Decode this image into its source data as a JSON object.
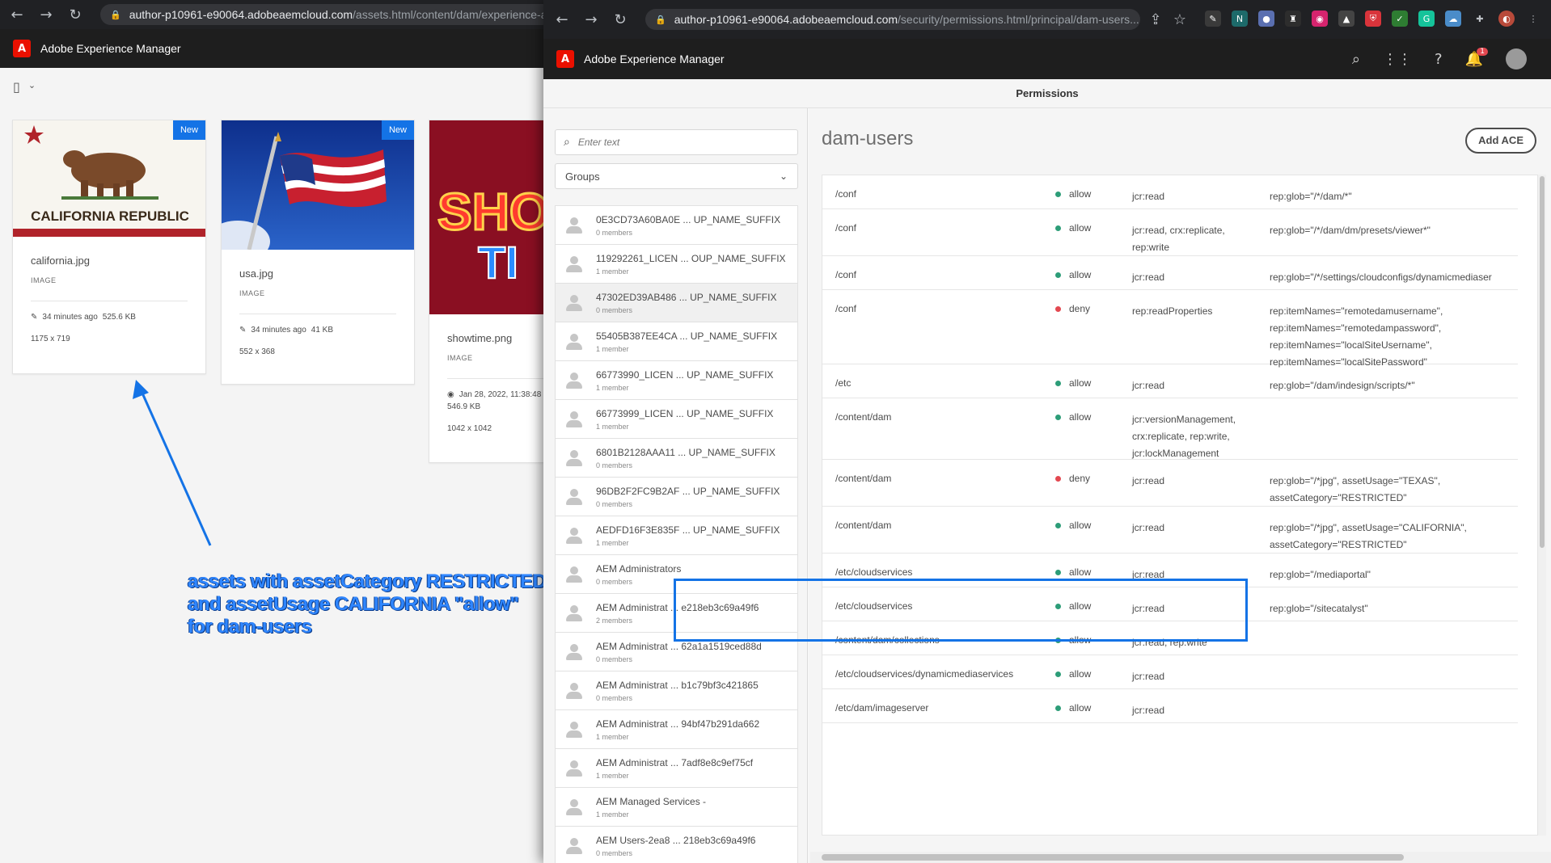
{
  "back_window": {
    "url_host": "author-p10961-e90064.adobeaemcloud.com",
    "url_path": "/assets.html/content/dam/experience-aem",
    "app_title": "Adobe Experience Manager",
    "cards": [
      {
        "name": "california.jpg",
        "type": "IMAGE",
        "modified": "34 minutes ago",
        "size": "525.6 KB",
        "dims": "1175 x 719",
        "badge": "New"
      },
      {
        "name": "usa.jpg",
        "type": "IMAGE",
        "modified": "34 minutes ago",
        "size": "41 KB",
        "dims": "552 x 368",
        "badge": "New"
      },
      {
        "name": "showtime.png",
        "type": "IMAGE",
        "modified": "Jan 28, 2022, 11:38:48",
        "size": "546.9 KB",
        "dims": "1042 x 1042",
        "badge": ""
      }
    ],
    "annotation": {
      "line1": "assets with assetCategory RESTRICTED",
      "line2": "and assetUsage CALIFORNIA \"allow\"",
      "line3": "for dam-users"
    },
    "flag_text": {
      "california": "CALIFORNIA REPUBLIC",
      "showtime_1": "SHO",
      "showtime_2": "TI"
    }
  },
  "front_window": {
    "url_host": "author-p10961-e90064.adobeaemcloud.com",
    "url_path": "/security/permissions.html/principal/dam-users...",
    "app_title": "Adobe Experience Manager",
    "notification_count": "1",
    "page_title": "Permissions",
    "search_placeholder": "Enter text",
    "filter_value": "Groups",
    "principal": "dam-users",
    "add_ace_label": "Add ACE",
    "groups": [
      {
        "name": "0E3CD73A60BA0E ... UP_NAME_SUFFIX",
        "members": "0 members"
      },
      {
        "name": "119292261_LICEN ... OUP_NAME_SUFFIX",
        "members": "1 member"
      },
      {
        "name": "47302ED39AB486 ... UP_NAME_SUFFIX",
        "members": "0 members"
      },
      {
        "name": "55405B387EE4CA ... UP_NAME_SUFFIX",
        "members": "1 member"
      },
      {
        "name": "66773990_LICEN ... UP_NAME_SUFFIX",
        "members": "1 member"
      },
      {
        "name": "66773999_LICEN ... UP_NAME_SUFFIX",
        "members": "1 member"
      },
      {
        "name": "6801B2128AAA11 ... UP_NAME_SUFFIX",
        "members": "0 members"
      },
      {
        "name": "96DB2F2FC9B2AF ... UP_NAME_SUFFIX",
        "members": "0 members"
      },
      {
        "name": "AEDFD16F3E835F ... UP_NAME_SUFFIX",
        "members": "1 member"
      },
      {
        "name": "AEM Administrators",
        "members": "0 members"
      },
      {
        "name": "AEM Administrat ... e218eb3c69a49f6",
        "members": "2 members"
      },
      {
        "name": "AEM Administrat ... 62a1a1519ced88d",
        "members": "0 members"
      },
      {
        "name": "AEM Administrat ... b1c79bf3c421865",
        "members": "0 members"
      },
      {
        "name": "AEM Administrat ... 94bf47b291da662",
        "members": "1 member"
      },
      {
        "name": "AEM Administrat ... 7adf8e8c9ef75cf",
        "members": "1 member"
      },
      {
        "name": "AEM Managed Services -",
        "members": "1 member"
      },
      {
        "name": "AEM Users-2ea8 ... 218eb3c69a49f6",
        "members": "0 members"
      }
    ],
    "aces": [
      {
        "path": "/conf",
        "type": "allow",
        "privileges": "jcr:read",
        "restrictions": "rep:glob=\"/*/dam/*\""
      },
      {
        "path": "/conf",
        "type": "allow",
        "privileges": "jcr:read, crx:replicate,\nrep:write",
        "restrictions": "rep:glob=\"/*/dam/dm/presets/viewer*\""
      },
      {
        "path": "/conf",
        "type": "allow",
        "privileges": "jcr:read",
        "restrictions": "rep:glob=\"/*/settings/cloudconfigs/dynamicmediaser"
      },
      {
        "path": "/conf",
        "type": "deny",
        "privileges": "rep:readProperties",
        "restrictions": "rep:itemNames=\"remotedamusername\",\nrep:itemNames=\"remotedampassword\",\nrep:itemNames=\"localSiteUsername\",\nrep:itemNames=\"localSitePassword\""
      },
      {
        "path": "/etc",
        "type": "allow",
        "privileges": "jcr:read",
        "restrictions": "rep:glob=\"/dam/indesign/scripts/*\""
      },
      {
        "path": "/content/dam",
        "type": "allow",
        "privileges": "jcr:versionManagement,\ncrx:replicate, rep:write,\njcr:lockManagement",
        "restrictions": ""
      },
      {
        "path": "/content/dam",
        "type": "deny",
        "privileges": "jcr:read",
        "restrictions": "rep:glob=\"/*jpg\", assetUsage=\"TEXAS\",\nassetCategory=\"RESTRICTED\""
      },
      {
        "path": "/content/dam",
        "type": "allow",
        "privileges": "jcr:read",
        "restrictions": "rep:glob=\"/*jpg\", assetUsage=\"CALIFORNIA\",\nassetCategory=\"RESTRICTED\""
      },
      {
        "path": "/etc/cloudservices",
        "type": "allow",
        "privileges": "jcr:read",
        "restrictions": "rep:glob=\"/mediaportal\""
      },
      {
        "path": "/etc/cloudservices",
        "type": "allow",
        "privileges": "jcr:read",
        "restrictions": "rep:glob=\"/sitecatalyst\""
      },
      {
        "path": "/content/dam/collections",
        "type": "allow",
        "privileges": "jcr:read, rep:write",
        "restrictions": ""
      },
      {
        "path": "/etc/cloudservices/dynamicmediaservices",
        "type": "allow",
        "privileges": "jcr:read",
        "restrictions": ""
      },
      {
        "path": "/etc/dam/imageserver",
        "type": "allow",
        "privileges": "jcr:read",
        "restrictions": ""
      }
    ]
  }
}
